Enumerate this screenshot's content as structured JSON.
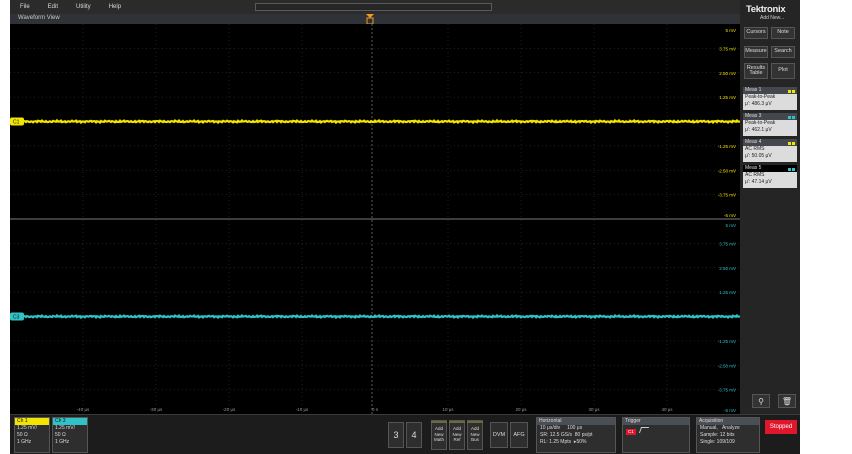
{
  "menu": [
    "File",
    "Edit",
    "Utility",
    "Help"
  ],
  "waveform_view": {
    "title": "Waveform View"
  },
  "brand": {
    "logo": "Tektronix",
    "add_new": "Add New..."
  },
  "side_buttons": [
    {
      "label": "Cursors"
    },
    {
      "label": "Note"
    },
    {
      "label": "Measure"
    },
    {
      "label": "Search"
    },
    {
      "label": "Results Table"
    },
    {
      "label": "Plot"
    }
  ],
  "measurements": [
    {
      "name": "Meas 1",
      "type": "Peak-to-Peak",
      "value": "μ': 486.3 μV",
      "color": "#f2e600"
    },
    {
      "name": "Meas 3",
      "type": "Peak-to-Peak",
      "value": "μ': 462.1 μV",
      "color": "#2fc3c9"
    },
    {
      "name": "Meas 4",
      "type": "AC RMS",
      "value": "μ': 50.05 μV",
      "color": "#f2e600"
    },
    {
      "name": "Meas 5",
      "type": "AC RMS",
      "value": "μ': 47.14 μV",
      "color": "#2fc3c9"
    }
  ],
  "ch1_scale": [
    "5 mV",
    "3.75 mV",
    "2.50 mV",
    "1.25 mV",
    "",
    "-1.25 mV",
    "-2.50 mV",
    "-3.75 mV",
    "-5 mV"
  ],
  "ch3_scale": [
    "5 mV",
    "3.75 mV",
    "2.50 mV",
    "1.25 mV",
    "",
    "-1.25 mV",
    "-2.50 mV",
    "-3.75 mV",
    "-5 mV"
  ],
  "time_ticks": [
    "-40 μs",
    "-30 μs",
    "-20 μs",
    "-10 μs",
    "0 s",
    "10 μs",
    "20 μs",
    "30 μs",
    "40 μs"
  ],
  "ch_labels": {
    "ch1": "C1",
    "ch3": "C3"
  },
  "colors": {
    "ch1": "#f2e600",
    "ch3": "#2fc3c9",
    "grid": "#3d3d3d",
    "stopped": "#e0162b"
  },
  "channels": [
    {
      "name": "Ch 1",
      "scale": "1.25 mV/",
      "impedance": "50 Ω",
      "bandwidth": "1 GHz",
      "color": "#f2e600"
    },
    {
      "name": "Ch 3",
      "scale": "1.25 mV/",
      "impedance": "50 Ω",
      "bandwidth": "1 GHz",
      "color": "#2fc3c9"
    }
  ],
  "extra_channels": [
    "3",
    "4"
  ],
  "add_buttons": [
    {
      "line1": "Add",
      "line2": "New",
      "line3": "Math"
    },
    {
      "line1": "Add",
      "line2": "New",
      "line3": "Ref"
    },
    {
      "line1": "Add",
      "line2": "New",
      "line3": "Bus"
    }
  ],
  "small_buttons": [
    "DVM",
    "AFG"
  ],
  "horizontal": {
    "title": "Horizontal",
    "l1a": "10 μs/div",
    "l1b": "100 μs",
    "l2a": "SR: 12.5 GS/s",
    "l2b": "80 ps/pt",
    "l3a": "RL: 1.25 Mpts",
    "l3b": "50%"
  },
  "trigger": {
    "title": "Trigger",
    "badge": "C1"
  },
  "acquisition": {
    "title": "Acquisition",
    "l1a": "Manual,",
    "l1b": "Analyze",
    "l2": "Sample: 12 bits",
    "l3": "Single: 109/109"
  },
  "status": {
    "label": "Stopped"
  }
}
